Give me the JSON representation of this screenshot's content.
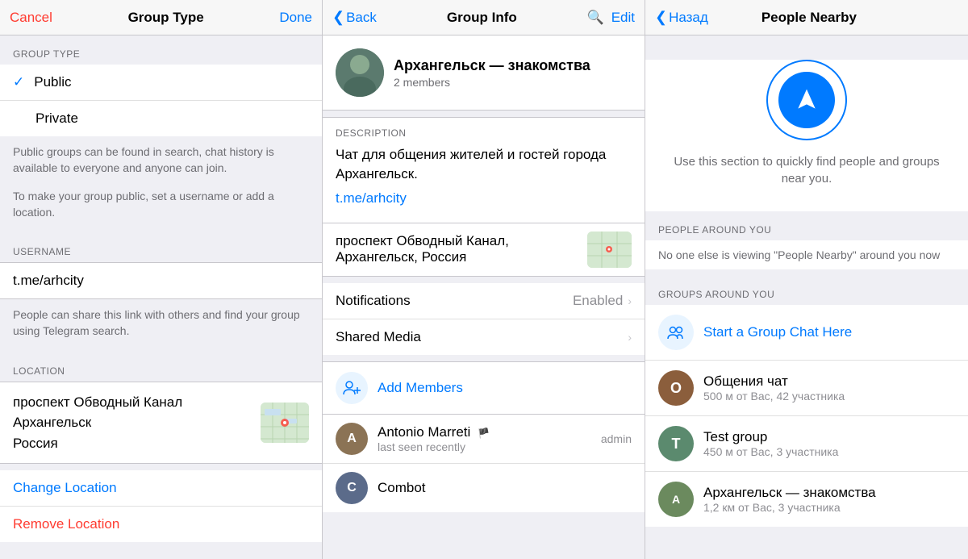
{
  "panel1": {
    "nav": {
      "cancel": "Cancel",
      "title": "Group Type",
      "done": "Done"
    },
    "section_group_type": "GROUP TYPE",
    "options": [
      {
        "label": "Public",
        "checked": true
      },
      {
        "label": "Private",
        "checked": false
      }
    ],
    "info_text1": "Public groups can be found in search, chat history is available to everyone and anyone can join.",
    "info_text2": "To make your group public, set a username or add a location.",
    "section_username": "USERNAME",
    "username_value": "t.me/arhcity",
    "username_info": "People can share this link with others and find your group using Telegram search.",
    "section_location": "LOCATION",
    "location_line1": "проспект Обводный Канал",
    "location_line2": "Архангельск",
    "location_line3": "Россия",
    "change_location": "Change Location",
    "remove_location": "Remove Location"
  },
  "panel2": {
    "nav": {
      "back": "Back",
      "title": "Group Info",
      "edit": "Edit"
    },
    "group": {
      "name": "Архангельск — знакомства",
      "members": "2 members"
    },
    "description_label": "DESCRIPTION",
    "description_text": "Чат для общения жителей и гостей города Архангельск.",
    "link": "t.me/arhcity",
    "location_text": "проспект Обводный Канал, Архангельск, Россия",
    "notifications": {
      "label": "Notifications",
      "value": "Enabled"
    },
    "shared_media": {
      "label": "Shared Media"
    },
    "add_members": "Add Members",
    "members": [
      {
        "name": "Antonio Marreti",
        "status": "last seen recently",
        "role": "admin",
        "has_flag": true,
        "avatar_color": "#8b7355",
        "avatar_letter": "A"
      },
      {
        "name": "Combot",
        "status": "",
        "role": "",
        "has_flag": false,
        "avatar_color": "#5b6b8a",
        "avatar_letter": "C"
      }
    ]
  },
  "panel3": {
    "nav": {
      "back": "Назад",
      "title": "People Nearby"
    },
    "description": "Use this section to quickly find people and groups near you.",
    "section_people": "PEOPLE AROUND YOU",
    "no_one_text": "No one else is viewing \"People Nearby\" around you now",
    "section_groups": "GROUPS AROUND YOU",
    "start_group": "Start a Group Chat Here",
    "groups": [
      {
        "name": "Общения чат",
        "distance": "500 м от Вас, 42 участника",
        "avatar_color": "#8b5e3c",
        "avatar_letter": "О"
      },
      {
        "name": "Test group",
        "distance": "450 м от Вас, 3 участника",
        "avatar_color": "#5b8a6e",
        "avatar_letter": "T"
      },
      {
        "name": "Архангельск — знакомства",
        "distance": "1,2 км от Вас, 3 участника",
        "avatar_color": "#6b8a5e",
        "avatar_letter": "А"
      }
    ]
  }
}
